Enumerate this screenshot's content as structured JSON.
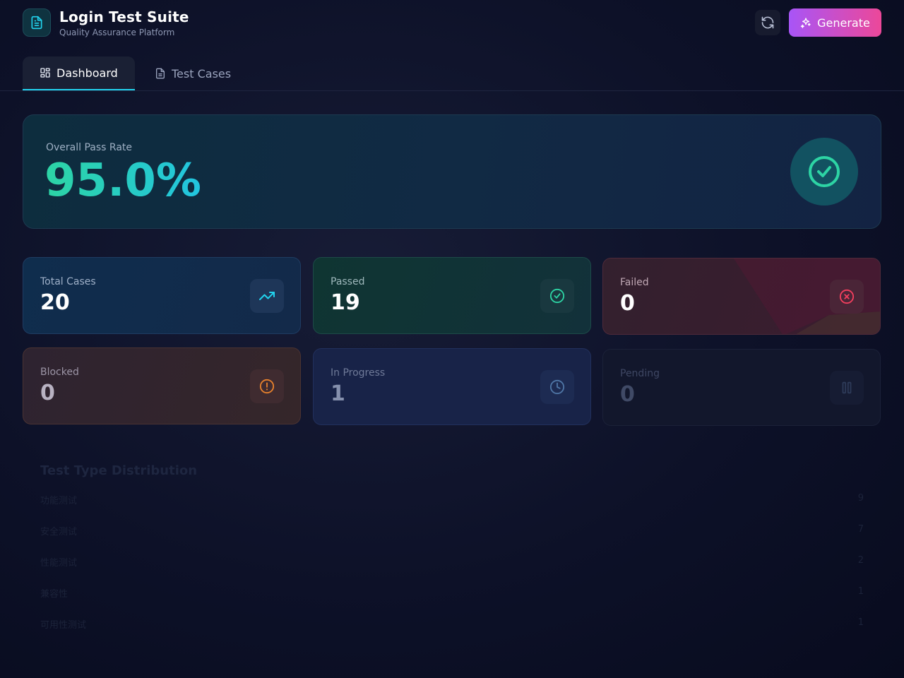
{
  "app": {
    "title": "Login Test Suite",
    "subtitle": "Quality Assurance Platform",
    "logo_icon": "document-icon"
  },
  "header": {
    "refresh_icon": "refresh-icon",
    "generate_label": "Generate",
    "generate_icon": "sparkles-icon",
    "generate_gradient": [
      "#a855f7",
      "#ec4899"
    ]
  },
  "tabs": [
    {
      "label": "Dashboard",
      "icon": "grid-icon",
      "active": true
    },
    {
      "label": "Test Cases",
      "icon": "document-icon",
      "active": false
    }
  ],
  "overview": {
    "label": "Overall Pass Rate",
    "value": "95.0%",
    "icon": "check-circle-icon",
    "accent": "#2dd4a4"
  },
  "stats": [
    {
      "label": "Total Cases",
      "value": "20",
      "icon": "trending-up-icon",
      "color": "#22d3ee"
    },
    {
      "label": "Passed",
      "value": "19",
      "icon": "check-circle-icon",
      "color": "#2dd4a4"
    },
    {
      "label": "Failed",
      "value": "0",
      "icon": "x-circle-icon",
      "color": "#f43f5e"
    },
    {
      "label": "Blocked",
      "value": "0",
      "icon": "alert-circle-icon",
      "color": "#f97316"
    },
    {
      "label": "In Progress",
      "value": "1",
      "icon": "clock-icon",
      "color": "#3b82f6"
    },
    {
      "label": "Pending",
      "value": "0",
      "icon": "pause-icon",
      "color": "#64748b"
    }
  ],
  "distribution": {
    "title": "Test Type Distribution",
    "rows": [
      {
        "name": "功能测试",
        "count": "9"
      },
      {
        "name": "安全测试",
        "count": "7"
      },
      {
        "name": "性能测试",
        "count": "2"
      },
      {
        "name": "兼容性",
        "count": "1"
      },
      {
        "name": "可用性测试",
        "count": "1"
      }
    ]
  }
}
